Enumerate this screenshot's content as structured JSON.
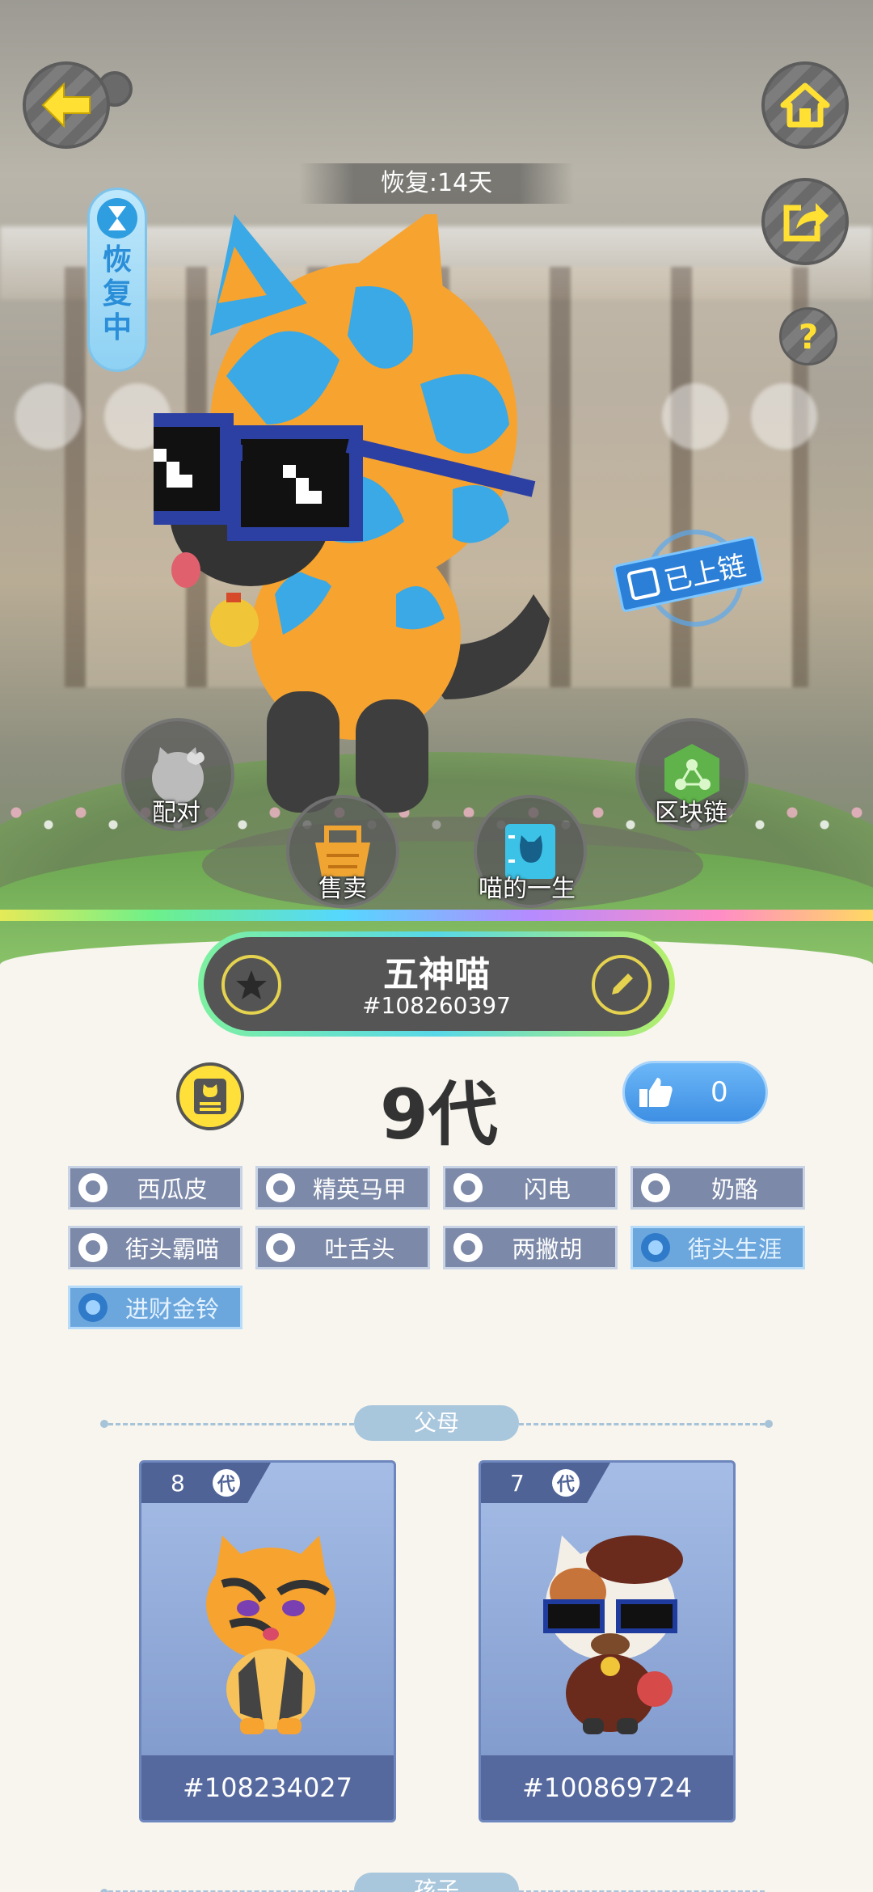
{
  "header": {
    "recovery_countdown": "恢复:14天",
    "status_pill": [
      "恢",
      "复",
      "中"
    ],
    "chain_badge": "已上链",
    "help_label": "?"
  },
  "actions": {
    "pair": "配对",
    "sell": "售卖",
    "life": "喵的一生",
    "blockchain": "区块链"
  },
  "cat": {
    "name": "五神喵",
    "id": "#108260397",
    "generation": "9代",
    "likes": "0"
  },
  "tags": [
    {
      "label": "西瓜皮",
      "special": false
    },
    {
      "label": "精英马甲",
      "special": false
    },
    {
      "label": "闪电",
      "special": false
    },
    {
      "label": "奶酪",
      "special": false
    },
    {
      "label": "街头霸喵",
      "special": false
    },
    {
      "label": "吐舌头",
      "special": false
    },
    {
      "label": "两撇胡",
      "special": false
    },
    {
      "label": "街头生涯",
      "special": true
    },
    {
      "label": "进财金铃",
      "special": true
    }
  ],
  "parents": {
    "title": "父母",
    "items": [
      {
        "gen": "8",
        "gen_suffix": "代",
        "id": "#108234027"
      },
      {
        "gen": "7",
        "gen_suffix": "代",
        "id": "#100869724"
      }
    ]
  },
  "children": {
    "title": "孩子"
  },
  "colors": {
    "accent_yellow": "#ffe033",
    "tag_bg": "#7c89a8",
    "tag_special_bg": "#6ba7dd",
    "card_blue": "#7b95c9",
    "like_blue": "#3e8fe4"
  }
}
